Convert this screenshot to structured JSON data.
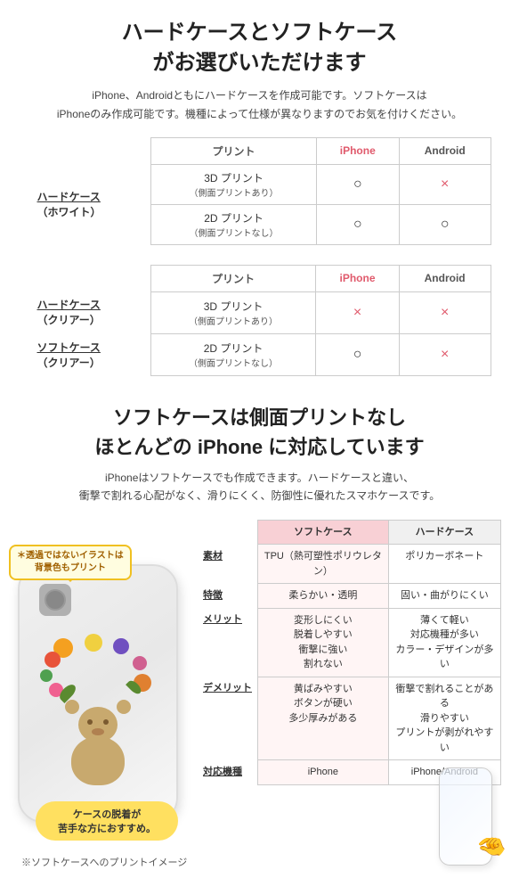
{
  "section1": {
    "title": "ハードケースとソフトケース\nがお選びいただけます",
    "description": "iPhone、Androidともにハードケースを作成可能です。ソフトケースは\niPhoneのみ作成可能です。機種によって仕様が異なりますのでお気を付けください。",
    "table1": {
      "col_headers": [
        "プリント",
        "iPhone",
        "Android"
      ],
      "row_groups": [
        {
          "group_label": "ハードケース\n（ホワイト）",
          "rows": [
            {
              "print": "3D プリント\n（側面プリントあり）",
              "iphone": "○",
              "android": "×"
            },
            {
              "print": "2D プリント\n（側面プリントなし）",
              "iphone": "○",
              "android": "○"
            }
          ]
        }
      ]
    },
    "table2": {
      "col_headers": [
        "プリント",
        "iPhone",
        "Android"
      ],
      "row_groups": [
        {
          "group_label1": "ハードケース\n（クリアー）",
          "group_label2": "ソフトケース\n（クリアー）",
          "rows": [
            {
              "print": "3D プリント\n（側面プリントあり）",
              "iphone": "×",
              "android": "×"
            },
            {
              "print": "2D プリント\n（側面プリントなし）",
              "iphone": "○",
              "android": "×"
            }
          ]
        }
      ]
    }
  },
  "section2": {
    "title": "ソフトケースは側面プリントなし\nほとんどの iPhone に対応しています",
    "description": "iPhoneはソフトケースでも作成できます。ハードケースと違い、\n衝撃で割れる心配がなく、滑りにくく、防御性に優れたスマホケースです。",
    "bubble_note": "＊透過ではないイラストは\n背景色もプリント",
    "detach_bubble": "ケースの脱着が\n苦手な方におすすめ。",
    "footer_note": "※ソフトケースへのプリントイメージ",
    "compare_table": {
      "col_soft": "ソフトケース",
      "col_hard": "ハードケース",
      "rows": [
        {
          "label": "素材",
          "soft": "TPU（熱可塑性ポリウレタン）",
          "hard": "ポリカーボネート"
        },
        {
          "label": "特徴",
          "soft": "柔らかい・透明",
          "hard": "固い・曲がりにくい"
        },
        {
          "label": "メリット",
          "soft": "変形しにくい\n脱着しやすい\n衝撃に強い\n割れない",
          "hard": "薄くて軽い\n対応機種が多い\nカラー・デザインが多い"
        },
        {
          "label": "デメリット",
          "soft": "黄ばみやすい\nボタンが硬い\n多少厚みがある",
          "hard": "衝撃で割れることがある\n滑りやすい\nプリントが剥がれやすい"
        },
        {
          "label": "対応機種",
          "soft": "iPhone",
          "hard": "iPhone/Android"
        }
      ]
    }
  }
}
